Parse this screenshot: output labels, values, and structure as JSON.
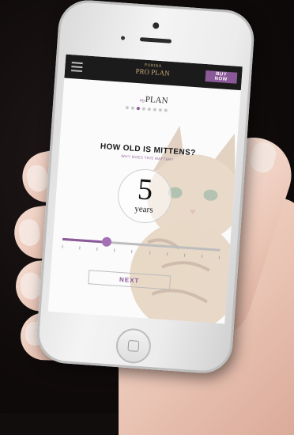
{
  "header": {
    "logo_top": "PURINA",
    "logo_main": "PRO PLAN",
    "logo_sub": "",
    "buy_label": "BUY NOW"
  },
  "plan": {
    "my": "my",
    "title": "PLAN",
    "steps_total": 8,
    "current_step": 3
  },
  "question": {
    "title": "HOW OLD IS MITTENS?",
    "subtitle": "WHY DOES THIS MATTER?"
  },
  "age": {
    "value": "5",
    "unit": "years",
    "slider_fraction": 0.28,
    "slider_ticks": 10
  },
  "next_label": "NEXT",
  "colors": {
    "accent": "#8a5a98",
    "topbar": "#1b1b1b",
    "background": "#120d0d"
  },
  "icons": {
    "menu": "hamburger-icon",
    "home": "home-button-icon"
  }
}
